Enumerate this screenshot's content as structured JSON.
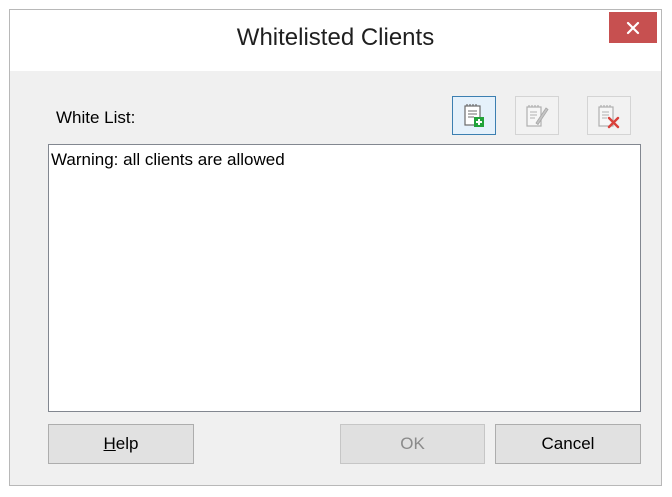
{
  "window": {
    "title": "Whitelisted Clients"
  },
  "whitelist": {
    "label": "White List:",
    "items": [
      "Warning: all clients are allowed"
    ]
  },
  "toolbar": [
    {
      "icon": "add-entry-icon",
      "state": "enabled"
    },
    {
      "icon": "edit-entry-icon",
      "state": "disabled"
    },
    {
      "icon": "delete-entry-icon",
      "state": "disabled"
    }
  ],
  "buttons": {
    "help_mnemonic": "H",
    "help_rest": "elp",
    "ok": "OK",
    "cancel": "Cancel"
  },
  "colors": {
    "close_button": "#c75050",
    "active_tool_border": "#3c7fb1",
    "add_icon_plus": "#22a33a",
    "delete_icon_x": "#d9413b"
  }
}
